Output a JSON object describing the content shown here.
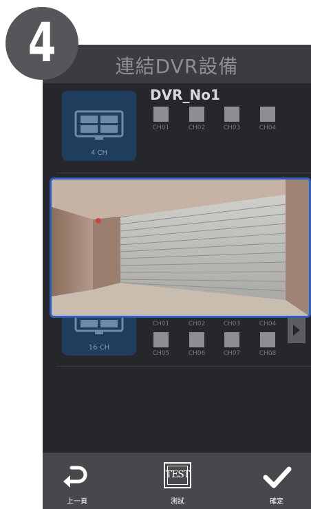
{
  "step_number": "4",
  "screen": {
    "title": "連結DVR設備"
  },
  "dvr1": {
    "name": "DVR_No1",
    "card_caption": "4 CH",
    "channels": [
      "CH01",
      "CH02",
      "CH03",
      "CH04"
    ]
  },
  "dvr2": {
    "card_caption": "16 CH",
    "channels_row1": [
      "CH01",
      "CH02",
      "CH03",
      "CH04"
    ],
    "channels_row2": [
      "CH05",
      "CH06",
      "CH07",
      "CH08"
    ]
  },
  "bottom_bar": {
    "back_label": "上一頁",
    "test_icon_text": "TEST",
    "test_label": "測試",
    "confirm_label": "確定"
  },
  "colors": {
    "screen_bg": "#26272b",
    "card_bg": "#1f3d5c",
    "selection_border": "#2a5fc8",
    "bottom_bar": "#47484c"
  }
}
